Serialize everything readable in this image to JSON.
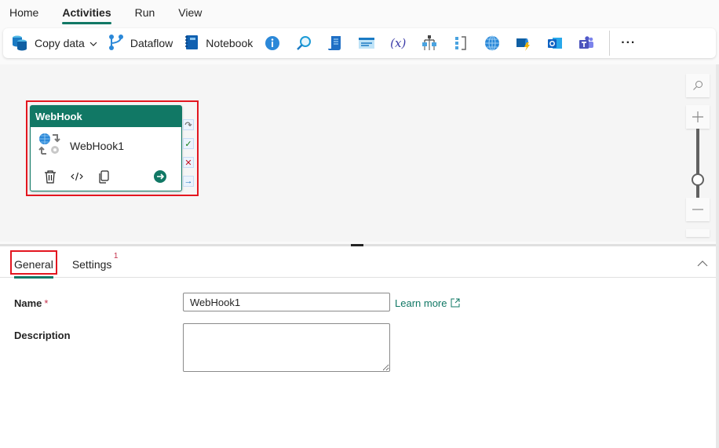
{
  "menu": {
    "tabs": [
      {
        "label": "Home",
        "active": false
      },
      {
        "label": "Activities",
        "active": true
      },
      {
        "label": "Run",
        "active": false
      },
      {
        "label": "View",
        "active": false
      }
    ]
  },
  "toolbar": {
    "copy_data_label": "Copy data",
    "dataflow_label": "Dataflow",
    "notebook_label": "Notebook",
    "icon_buttons": [
      "get-metadata-icon",
      "lookup-icon",
      "script-icon",
      "set-variable-icon",
      "expression-icon",
      "switch-icon",
      "if-condition-icon",
      "web-icon",
      "azure-function-icon",
      "outlook-icon",
      "teams-icon"
    ],
    "more_label": "···"
  },
  "canvas": {
    "activity": {
      "type_label": "WebHook",
      "name": "WebHook1",
      "header_color": "#117865"
    },
    "highlight_color": "#e3161f",
    "zoom_level": 0.5
  },
  "properties": {
    "tabs": [
      {
        "label": "General",
        "active": true
      },
      {
        "label": "Settings",
        "badge": "1"
      }
    ],
    "fields": {
      "name_label": "Name",
      "required_mark": "*",
      "name_value": "WebHook1",
      "description_label": "Description",
      "description_value": "",
      "learn_more_label": "Learn more"
    }
  },
  "colors": {
    "accent": "#117865",
    "error": "#c4314b"
  }
}
